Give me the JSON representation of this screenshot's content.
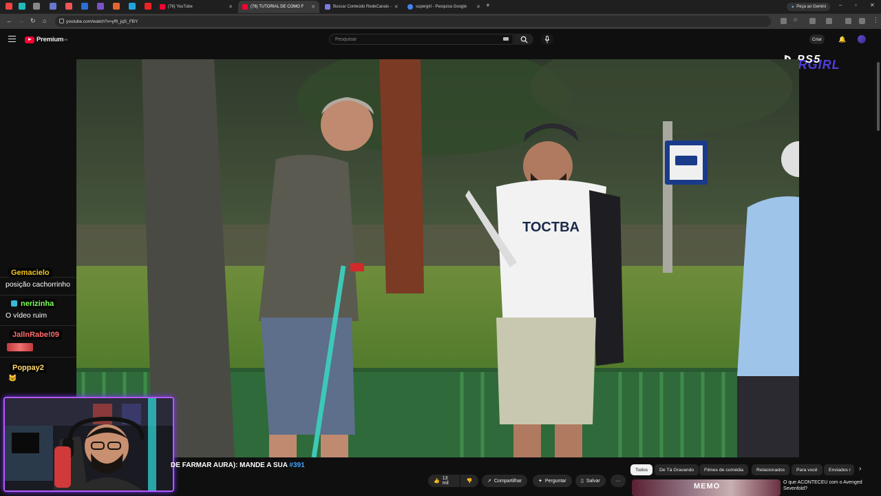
{
  "browser": {
    "tabs": [
      {
        "label": "(76) YouTube",
        "favicon_color": "#ff0033"
      },
      {
        "label": "(76) TUTORIAL DE COMO F",
        "favicon_color": "#ff0033",
        "active": true
      },
      {
        "label": "Buscar Conteúdo RedeCanais -",
        "favicon_color": "#7a7adf"
      },
      {
        "label": "supergirl - Pesquisa Google",
        "favicon_color": "#4285f4"
      }
    ],
    "new_tab": "+",
    "gemini_label": "Peça ao Gemini",
    "url": "youtube.com/watch?v=yfft_jqS_FBY"
  },
  "youtube": {
    "logo_text": "Premium",
    "logo_sup": "BR",
    "search_placeholder": "Pesquisar",
    "create_label": "Criar",
    "video_title_text": "DE FARMAR AURA): MANDE A SUA",
    "video_title_tag": "#391",
    "actions": {
      "like_count": "13 mil",
      "share": "Compartilhar",
      "ask": "Perguntar",
      "save": "Salvar",
      "more": "···"
    },
    "chips": [
      "Todos",
      "De Tá Gravando",
      "Filmes de comédia",
      "Relacionados",
      "Para você",
      "Enviados r"
    ],
    "recommendation": {
      "title": "O que ACONTECEU com o Avenged Sevenfold?",
      "thumb_text": "MEMO"
    }
  },
  "overlay": {
    "ps5_label": "PS5",
    "glitch_text": "STARGIRL"
  },
  "chat": [
    {
      "name": "Gemacielo",
      "message": "posição cachorrinho",
      "name_color": "#f0c419"
    },
    {
      "name": "nerizinha",
      "message": "O vídeo ruim",
      "name_color": "#7cff5a"
    },
    {
      "name": "JallnRabe!09",
      "message": "",
      "name_color": "#ff6b6b"
    },
    {
      "name": "Poppay2",
      "message": "",
      "name_color": "#ffd86b"
    }
  ]
}
